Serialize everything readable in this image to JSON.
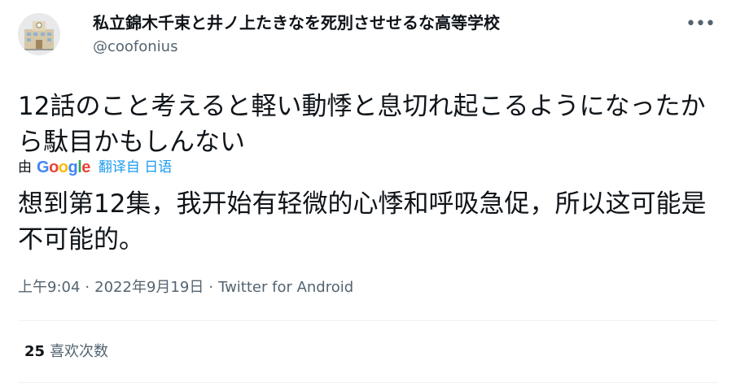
{
  "author": {
    "display_name": "私立錦木千束と井ノ上たきなを死別させせるな高等学校",
    "handle": "@coofonius",
    "avatar_icon": "school-building-icon"
  },
  "more_icon": "more-options-icon",
  "tweet": {
    "text": "12話のこと考えると軽い動悸と息切れ起こるようになったから駄目かもしんない",
    "translated_text": "想到第12集，我开始有轻微的心悸和呼吸急促，所以这可能是不可能的。"
  },
  "translation": {
    "by_label": "由",
    "google_logo": "Google",
    "link": "翻译自 日语"
  },
  "meta": {
    "time": "上午9:04",
    "separator": "·",
    "date": "2022年9月19日",
    "source": "Twitter for Android"
  },
  "stats": {
    "likes_count": "25",
    "likes_label": "喜欢次数"
  },
  "colors": {
    "text_primary": "#0f1419",
    "text_secondary": "#536471",
    "link": "#1d9bf0",
    "divider": "#eff3f4"
  }
}
